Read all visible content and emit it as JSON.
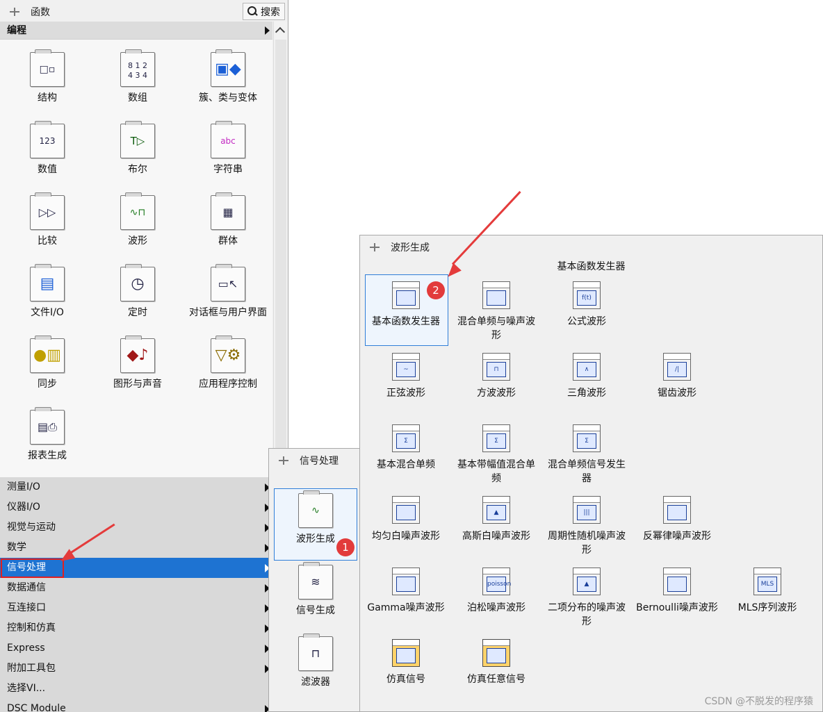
{
  "functions_palette": {
    "title": "函数",
    "search_label": "搜索",
    "section_header": "编程",
    "icons": [
      {
        "label": "结构",
        "icon": "structure-icon"
      },
      {
        "label": "数组",
        "icon": "array-icon"
      },
      {
        "label": "簇、类与变体",
        "icon": "cluster-icon"
      },
      {
        "label": "数值",
        "icon": "numeric-icon"
      },
      {
        "label": "布尔",
        "icon": "boolean-icon"
      },
      {
        "label": "字符串",
        "icon": "string-icon"
      },
      {
        "label": "比较",
        "icon": "comparison-icon"
      },
      {
        "label": "波形",
        "icon": "waveform-icon"
      },
      {
        "label": "群体",
        "icon": "group-icon"
      },
      {
        "label": "文件I/O",
        "icon": "file-io-icon"
      },
      {
        "label": "定时",
        "icon": "timing-icon"
      },
      {
        "label": "对话框与用户界面",
        "icon": "dialog-icon"
      },
      {
        "label": "同步",
        "icon": "sync-icon"
      },
      {
        "label": "图形与声音",
        "icon": "graphics-sound-icon"
      },
      {
        "label": "应用程序控制",
        "icon": "app-control-icon"
      },
      {
        "label": "报表生成",
        "icon": "report-icon"
      }
    ],
    "categories": [
      {
        "label": "测量I/O"
      },
      {
        "label": "仪器I/O"
      },
      {
        "label": "视觉与运动"
      },
      {
        "label": "数学"
      },
      {
        "label": "信号处理",
        "selected": true
      },
      {
        "label": "数据通信"
      },
      {
        "label": "互连接口"
      },
      {
        "label": "控制和仿真"
      },
      {
        "label": "Express"
      },
      {
        "label": "附加工具包"
      },
      {
        "label": "选择VI..."
      },
      {
        "label": "DSC Module"
      }
    ]
  },
  "signal_processing_palette": {
    "title": "信号处理",
    "items": [
      {
        "label": "波形生成",
        "highlighted": true,
        "badge": "1"
      },
      {
        "label": "信号生成"
      },
      {
        "label": "滤波器"
      }
    ]
  },
  "waveform_generation_palette": {
    "title": "波形生成",
    "section_title": "基本函数发生器",
    "items": [
      {
        "label": "基本函数发生器",
        "glyph": "",
        "highlighted": true,
        "badge": "2"
      },
      {
        "label": "混合单频与噪声波形",
        "glyph": ""
      },
      {
        "label": "公式波形",
        "glyph": "f(t)"
      },
      {
        "label": "正弦波形",
        "glyph": "~"
      },
      {
        "label": "方波波形",
        "glyph": "⊓"
      },
      {
        "label": "三角波形",
        "glyph": "∧"
      },
      {
        "label": "锯齿波形",
        "glyph": "/|"
      },
      {
        "label": "基本混合单频",
        "glyph": "Σ"
      },
      {
        "label": "基本带幅值混合单频",
        "glyph": "Σ"
      },
      {
        "label": "混合单频信号发生器",
        "glyph": "Σ"
      },
      {
        "label": "均匀白噪声波形",
        "glyph": ""
      },
      {
        "label": "高斯白噪声波形",
        "glyph": "▲"
      },
      {
        "label": "周期性随机噪声波形",
        "glyph": "|||"
      },
      {
        "label": "反幂律噪声波形",
        "glyph": ""
      },
      {
        "label": "Gamma噪声波形",
        "glyph": ""
      },
      {
        "label": "泊松噪声波形",
        "glyph": "poisson"
      },
      {
        "label": "二项分布的噪声波形",
        "glyph": "▲"
      },
      {
        "label": "Bernoulli噪声波形",
        "glyph": ""
      },
      {
        "label": "MLS序列波形",
        "glyph": "MLS"
      },
      {
        "label": "仿真信号",
        "glyph": "",
        "sim": true
      },
      {
        "label": "仿真任意信号",
        "glyph": "",
        "sim": true
      }
    ]
  },
  "watermark": "CSDN @不脱发的程序猿",
  "colors": {
    "selection": "#1e73d2",
    "annotation": "#e43b3b",
    "highlight_border": "#2f7ed8"
  }
}
